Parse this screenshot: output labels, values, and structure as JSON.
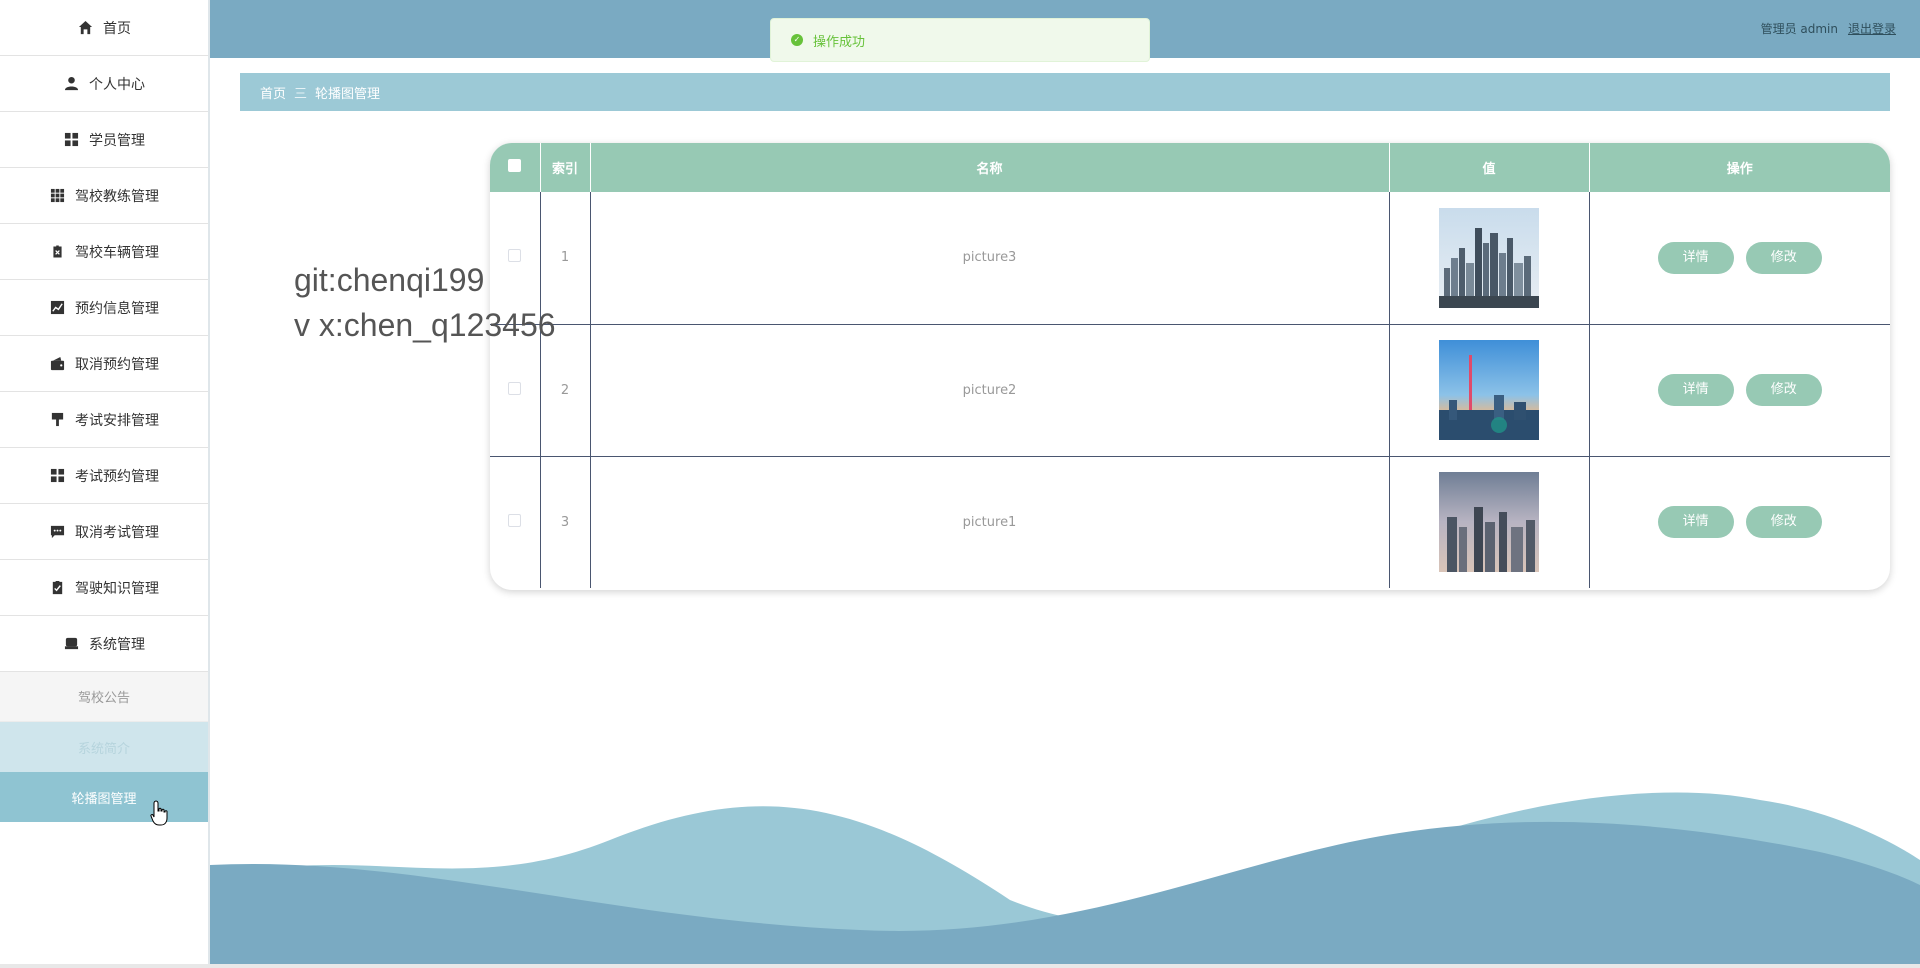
{
  "sidebar": {
    "items": [
      {
        "label": "首页",
        "icon": "home-icon"
      },
      {
        "label": "个人中心",
        "icon": "user-icon"
      },
      {
        "label": "学员管理",
        "icon": "grid-icon"
      },
      {
        "label": "驾校教练管理",
        "icon": "apps-icon"
      },
      {
        "label": "驾校车辆管理",
        "icon": "clipboard-x-icon"
      },
      {
        "label": "预约信息管理",
        "icon": "chart-icon"
      },
      {
        "label": "取消预约管理",
        "icon": "wallet-icon"
      },
      {
        "label": "考试安排管理",
        "icon": "brush-icon"
      },
      {
        "label": "考试预约管理",
        "icon": "grid-icon"
      },
      {
        "label": "取消考试管理",
        "icon": "message-icon"
      },
      {
        "label": "驾驶知识管理",
        "icon": "clipboard-check-icon"
      },
      {
        "label": "系统管理",
        "icon": "store-icon"
      }
    ],
    "sub_items": [
      {
        "label": "驾校公告"
      },
      {
        "label": "系统简介"
      },
      {
        "label": "轮播图管理"
      }
    ]
  },
  "header": {
    "user_label": "管理员 admin",
    "logout_label": "退出登录"
  },
  "toast": {
    "message": "操作成功",
    "color": "#67c23a"
  },
  "breadcrumb": {
    "home": "首页",
    "separator": "三",
    "current": "轮播图管理"
  },
  "watermark": {
    "line1": "git:chenqi199",
    "line2": "v x:chen_q123456"
  },
  "table": {
    "headers": {
      "index": "索引",
      "name": "名称",
      "value": "值",
      "actions": "操作"
    },
    "rows": [
      {
        "index": "1",
        "name": "picture3",
        "detail_label": "详情",
        "edit_label": "修改"
      },
      {
        "index": "2",
        "name": "picture2",
        "detail_label": "详情",
        "edit_label": "修改"
      },
      {
        "index": "3",
        "name": "picture1",
        "detail_label": "详情",
        "edit_label": "修改"
      }
    ]
  },
  "colors": {
    "header_bg": "#7aaac2",
    "table_header_bg": "#97c9b4",
    "breadcrumb_bg": "#9cc9d6",
    "active_menu_bg": "#8fc4d2"
  }
}
